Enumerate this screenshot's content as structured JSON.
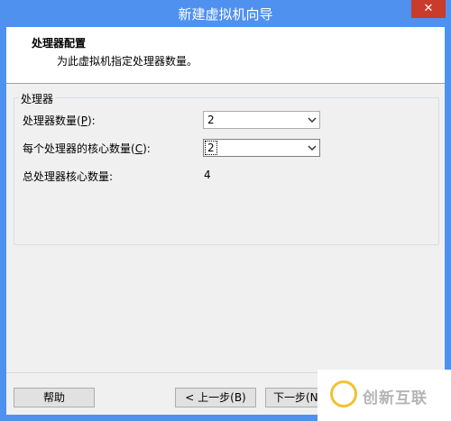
{
  "window": {
    "title": "新建虚拟机向导",
    "close_glyph": "✕"
  },
  "header": {
    "title": "处理器配置",
    "subtitle": "为此虚拟机指定处理器数量。"
  },
  "processors": {
    "group_label": "处理器",
    "count_label_pre": "处理器数量(",
    "count_label_key": "P",
    "count_label_post": "):",
    "count_value": "2",
    "cores_label_pre": "每个处理器的核心数量(",
    "cores_label_key": "C",
    "cores_label_post": "):",
    "cores_value": "2",
    "total_label": "总处理器核心数量:",
    "total_value": "4"
  },
  "buttons": {
    "help": "帮助",
    "back": "< 上一步(B)",
    "next": "下一步(N"
  },
  "watermark": {
    "text": "创新互联"
  },
  "icons": {
    "close": "close-icon",
    "dropdown": "chevron-down-icon",
    "logo": "watermark-logo-icon"
  },
  "colors": {
    "titlebar": "#4f91ee",
    "close": "#c93b2c",
    "client": "#f0f0f0"
  }
}
